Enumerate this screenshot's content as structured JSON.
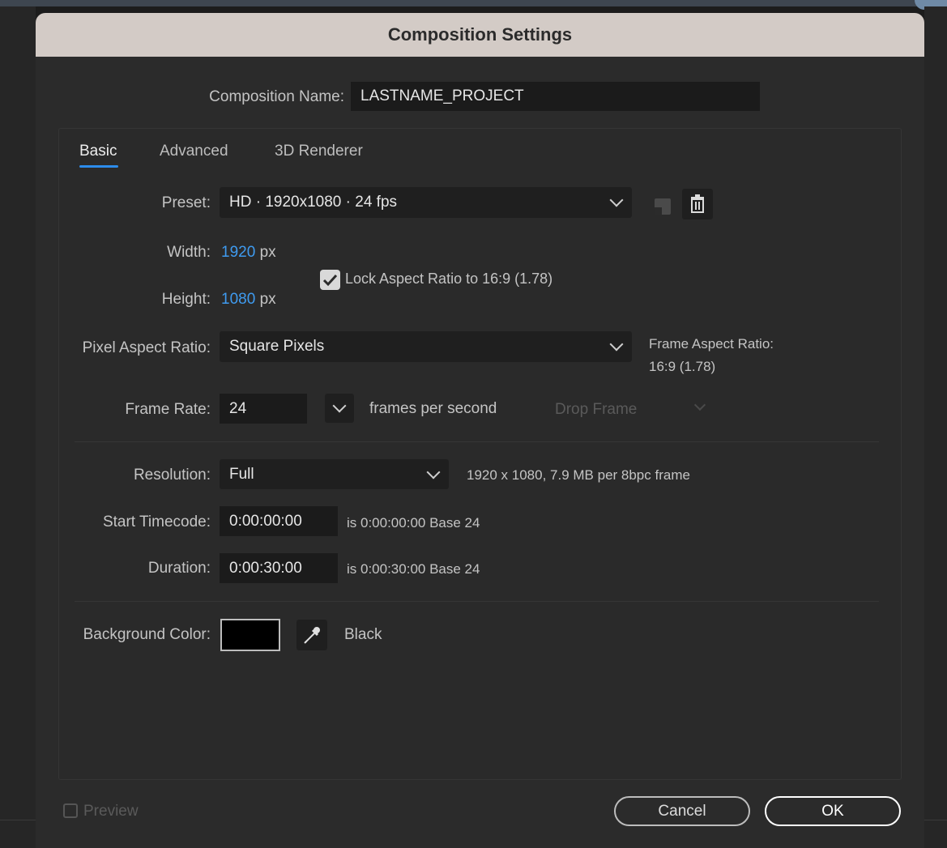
{
  "window": {
    "title": "Composition Settings"
  },
  "composition": {
    "name_label": "Composition Name:",
    "name_value": "LASTNAME_PROJECT"
  },
  "tabs": [
    {
      "label": "Basic",
      "active": true
    },
    {
      "label": "Advanced",
      "active": false
    },
    {
      "label": "3D Renderer",
      "active": false
    }
  ],
  "preset": {
    "label": "Preset:",
    "value": "HD  ·  1920x1080 · 24 fps",
    "save_icon": "save-preset-icon",
    "delete_icon": "trash-icon"
  },
  "size": {
    "width_label": "Width:",
    "width_value": "1920",
    "width_unit": "px",
    "height_label": "Height:",
    "height_value": "1080",
    "height_unit": "px",
    "lock_label": "Lock Aspect Ratio to 16:9 (1.78)",
    "lock_checked": true
  },
  "pixel_aspect": {
    "label": "Pixel Aspect Ratio:",
    "value": "Square Pixels",
    "frame_aspect_label": "Frame Aspect Ratio:",
    "frame_aspect_value": "16:9 (1.78)"
  },
  "frame_rate": {
    "label": "Frame Rate:",
    "value": "24",
    "unit": "frames per second",
    "drop_frame": "Drop Frame"
  },
  "resolution": {
    "label": "Resolution:",
    "value": "Full",
    "info": "1920 x 1080, 7.9 MB per 8bpc frame"
  },
  "start_timecode": {
    "label": "Start Timecode:",
    "value": "0:00:00:00",
    "info": "is 0:00:00:00  Base 24"
  },
  "duration": {
    "label": "Duration:",
    "value": "0:00:30:00",
    "info": "is 0:00:30:00  Base 24"
  },
  "background": {
    "label": "Background Color:",
    "swatch_color": "#000000",
    "color_name": "Black",
    "eyedropper_icon": "eyedropper-icon"
  },
  "footer": {
    "preview_label": "Preview",
    "preview_checked": false,
    "cancel_label": "Cancel",
    "ok_label": "OK"
  },
  "colors": {
    "accent": "#2d8ceb",
    "value_blue": "#3f9bf0",
    "title_bar": "#d3cbc6"
  }
}
